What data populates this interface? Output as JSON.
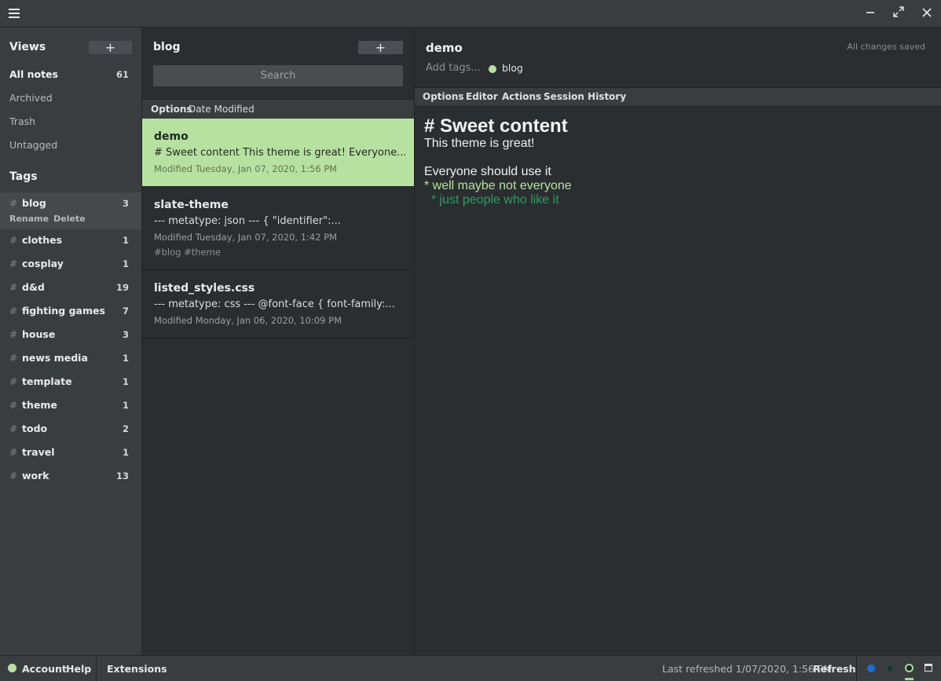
{
  "window": {
    "menu_icon": "hamburger-icon",
    "minimize_icon": "minimize-icon",
    "maximize_icon": "maximize-icon",
    "close_icon": "close-icon"
  },
  "sidebar": {
    "views_title": "Views",
    "add_label": "+",
    "views": [
      {
        "label": "All notes",
        "count": "61"
      },
      {
        "label": "Archived"
      },
      {
        "label": "Trash"
      },
      {
        "label": "Untagged"
      }
    ],
    "tags_title": "Tags",
    "tag_actions": {
      "rename": "Rename",
      "delete": "Delete"
    },
    "tags": [
      {
        "name": "blog",
        "count": "3"
      },
      {
        "name": "clothes",
        "count": "1"
      },
      {
        "name": "cosplay",
        "count": "1"
      },
      {
        "name": "d&d",
        "count": "19"
      },
      {
        "name": "fighting games",
        "count": "7"
      },
      {
        "name": "house",
        "count": "3"
      },
      {
        "name": "news media",
        "count": "1"
      },
      {
        "name": "template",
        "count": "1"
      },
      {
        "name": "theme",
        "count": "1"
      },
      {
        "name": "todo",
        "count": "2"
      },
      {
        "name": "travel",
        "count": "1"
      },
      {
        "name": "work",
        "count": "13"
      }
    ]
  },
  "notes": {
    "title": "blog",
    "add_label": "+",
    "search_placeholder": "Search",
    "options_label": "Options",
    "sort_label": "Date Modified",
    "items": [
      {
        "title": "demo",
        "preview": "# Sweet content This theme is great! Everyone...",
        "date": "Modified Tuesday, Jan 07, 2020, 1:56 PM"
      },
      {
        "title": "slate-theme",
        "preview": "--- metatype: json --- { \"identifier\":...",
        "date": "Modified Tuesday, Jan 07, 2020, 1:42 PM",
        "tags": "#blog #theme"
      },
      {
        "title": "listed_styles.css",
        "preview": "--- metatype: css --- @font-face { font-family:...",
        "date": "Modified Monday, Jan 06, 2020, 10:09 PM"
      }
    ]
  },
  "editor": {
    "title": "demo",
    "saved_status": "All changes saved",
    "add_tags_placeholder": "Add tags...",
    "tag": "blog",
    "menu": {
      "options": "Options",
      "editor": "Editor",
      "actions": "Actions",
      "session_history": "Session History"
    },
    "content": {
      "heading": "# Sweet content",
      "line1": "This theme is great!",
      "line2": "Everyone should use it",
      "line3": "* well maybe not everyone",
      "line4": "  * just people who like it"
    }
  },
  "footer": {
    "account": "Account",
    "help": "Help",
    "extensions": "Extensions",
    "last_refreshed": "Last refreshed 1/07/2020, 1:56 PM",
    "refresh": "Refresh"
  },
  "colors": {
    "accent_green": "#b7e1a1",
    "dark_green": "#2e9c62",
    "status_blue": "#1a6fd4"
  }
}
